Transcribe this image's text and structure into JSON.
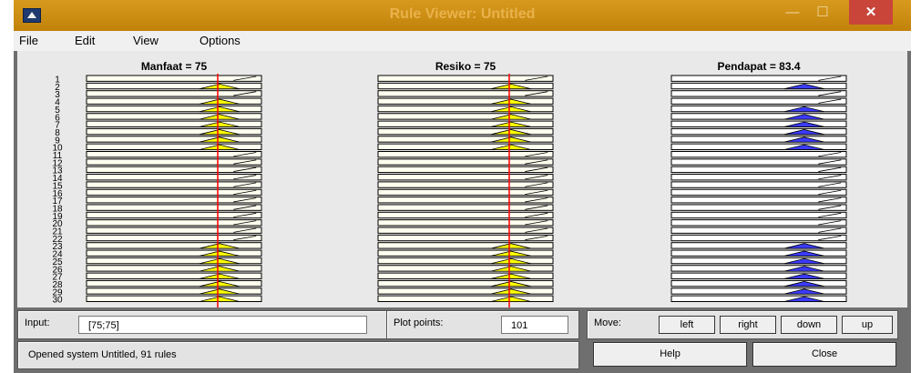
{
  "window": {
    "title": "Rule Viewer: Untitled",
    "minimize_glyph": "—",
    "maximize_glyph": "☐",
    "close_glyph": "✕",
    "icon": "matlab-icon"
  },
  "menu": [
    "File",
    "Edit",
    "View",
    "Options"
  ],
  "columns": [
    {
      "title": "Manfaat = 75",
      "input_value": 75,
      "range": [
        0,
        100
      ],
      "color": "#ffff00"
    },
    {
      "title": "Resiko = 75",
      "input_value": 75,
      "range": [
        0,
        100
      ],
      "color": "#ffff00"
    },
    {
      "title": "Pendapat = 83.4",
      "output_value": 83.4,
      "range": [
        0,
        100
      ],
      "color": "#3b3bff"
    }
  ],
  "rule_numbers": [
    "1",
    "2",
    "3",
    "4",
    "5",
    "6",
    "7",
    "8",
    "9",
    "10",
    "11",
    "12",
    "13",
    "14",
    "15",
    "16",
    "17",
    "18",
    "19",
    "20",
    "21",
    "22",
    "23",
    "24",
    "25",
    "26",
    "27",
    "28",
    "29",
    "30"
  ],
  "rule_kinds": {
    "inputs_active": [
      0,
      1,
      0,
      1,
      1,
      1,
      1,
      1,
      1,
      1,
      0,
      0,
      0,
      0,
      0,
      0,
      0,
      0,
      0,
      0,
      0,
      0,
      1,
      1,
      1,
      1,
      1,
      1,
      1,
      1
    ],
    "output_active": [
      0,
      1,
      0,
      0,
      1,
      1,
      1,
      1,
      1,
      1,
      0,
      0,
      0,
      0,
      0,
      0,
      0,
      0,
      0,
      0,
      0,
      0,
      1,
      1,
      1,
      1,
      1,
      1,
      1,
      1
    ]
  },
  "controls": {
    "input_label": "Input:",
    "input_value": "[75;75]",
    "plot_points_label": "Plot points:",
    "plot_points_value": "101",
    "move_label": "Move:",
    "move_buttons": [
      "left",
      "right",
      "down",
      "up"
    ],
    "status": "Opened system Untitled, 91 rules",
    "help_label": "Help",
    "close_label": "Close"
  },
  "colors": {
    "title_bar": "#c88a10",
    "close_button": "#c9453a",
    "input_fill": "#ffff00",
    "output_fill": "#3b3bff",
    "input_line": "#ff0000"
  }
}
